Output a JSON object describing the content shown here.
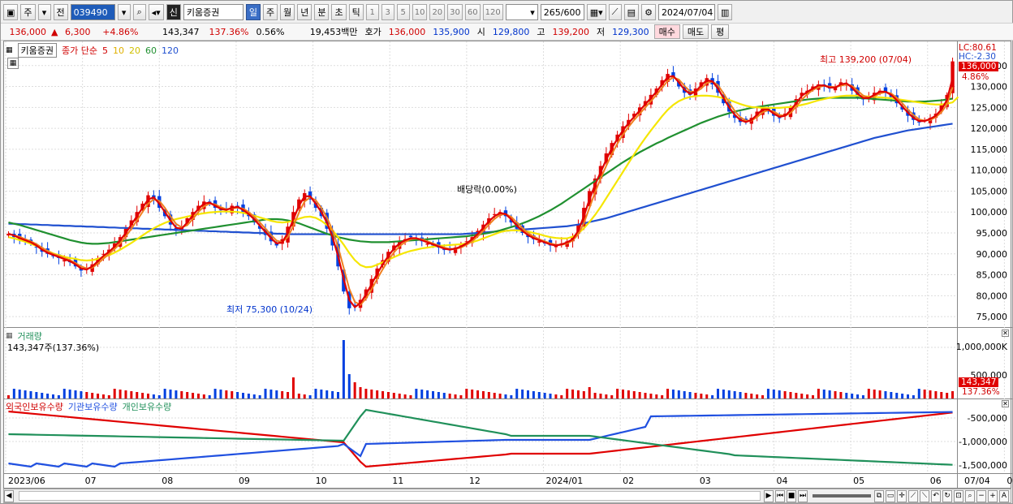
{
  "toolbar": {
    "tab1": "주",
    "tab2": "전",
    "code": "039490",
    "stock_name": "키움증권",
    "period_buttons": [
      "일",
      "주",
      "월",
      "년",
      "분",
      "초",
      "틱"
    ],
    "number_buttons": [
      "1",
      "3",
      "5",
      "10",
      "20",
      "30",
      "60",
      "120"
    ],
    "count": "265",
    "count_total": "/600",
    "date": "2024/07/04",
    "badge": "신"
  },
  "quote": {
    "price": "136,000",
    "change": "6,300",
    "rate": "+4.86%",
    "volume": "143,347",
    "volume_ratio": "137.36%",
    "turnover": "0.56%",
    "amount": "19,453백만",
    "hoga_label": "호가",
    "ask": "136,000",
    "bid": "135,900",
    "open_label": "시",
    "open": "129,800",
    "high_label": "고",
    "high": "139,200",
    "low_label": "저",
    "low": "129,300",
    "buy": "매수",
    "sell": "매도",
    "eval": "평"
  },
  "price_panel": {
    "stock_label": "키움증권",
    "ma_label": "종가 단순",
    "ma_periods": [
      "5",
      "10",
      "20",
      "60",
      "120"
    ],
    "lc": "LC:80.61",
    "hc": "HC:-2.30",
    "current_tag": "136,000",
    "rate_tag": "4.86%",
    "high_note": "최고 139,200 (07/04)",
    "low_note": "최저 75,300 (10/24)",
    "dividend_note": "배당락(0.00%)",
    "y_ticks": [
      "135,000",
      "130,000",
      "125,000",
      "120,000",
      "115,000",
      "110,000",
      "105,000",
      "100,000",
      "95,000",
      "90,000",
      "85,000",
      "80,000",
      "75,000"
    ]
  },
  "volume_panel": {
    "title": "거래량",
    "value": "143,347주(137.36%)",
    "y_ticks": [
      "1,000,000K",
      "500,000"
    ],
    "tag1": "143,347",
    "tag2": "137.36%"
  },
  "holding_panel": {
    "legend": [
      "외국인보유수량",
      "기관보유수량",
      "개인보유수량"
    ],
    "y_ticks": [
      "-500,000",
      "-1,000,000",
      "-1,500,000"
    ]
  },
  "x_axis": [
    "2023/06",
    "07",
    "08",
    "09",
    "10",
    "11",
    "12",
    "2024/01",
    "02",
    "03",
    "04",
    "05",
    "06",
    "07",
    "07/04"
  ],
  "colors": {
    "up": "#e00000",
    "down": "#0040e0",
    "ma5": "#e00000",
    "ma10": "#f08020",
    "ma20": "#f5e600",
    "ma60": "#209030",
    "ma120": "#2050d0",
    "foreign": "#e00000",
    "inst": "#2050e0",
    "indiv": "#20905a"
  },
  "chart_data": {
    "type": "line",
    "price_axis": {
      "min": 72500,
      "max": 140000
    },
    "price_close": [
      94800,
      94000,
      93500,
      93000,
      92500,
      91500,
      90500,
      90000,
      89500,
      89000,
      88500,
      88000,
      87000,
      86000,
      86500,
      87500,
      89000,
      90000,
      91000,
      92500,
      94000,
      96000,
      98000,
      100000,
      102000,
      104000,
      103000,
      101000,
      99000,
      97000,
      95500,
      96500,
      98500,
      100000,
      101500,
      102500,
      102000,
      101000,
      100500,
      100500,
      101500,
      101000,
      100000,
      99000,
      97500,
      96000,
      94500,
      93000,
      92000,
      93500,
      96500,
      100000,
      103000,
      104500,
      103000,
      101000,
      99000,
      96000,
      92000,
      87000,
      81000,
      77000,
      77500,
      79000,
      81500,
      84000,
      86500,
      88500,
      90500,
      92000,
      93000,
      93500,
      94000,
      93500,
      93000,
      92500,
      92000,
      91500,
      91000,
      91000,
      91500,
      92000,
      93000,
      94000,
      95500,
      97000,
      98500,
      99500,
      100000,
      99000,
      97500,
      96000,
      95000,
      94000,
      93500,
      93000,
      92500,
      92000,
      92000,
      92500,
      93000,
      94000,
      97000,
      101000,
      105000,
      108000,
      111000,
      114000,
      116500,
      118500,
      120500,
      122000,
      123500,
      125000,
      126500,
      128000,
      129500,
      131500,
      133000,
      132000,
      130000,
      128500,
      128000,
      129500,
      131000,
      132000,
      130500,
      128500,
      126000,
      124000,
      122500,
      121500,
      121500,
      122500,
      124000,
      125000,
      124000,
      123000,
      122500,
      123500,
      125000,
      127000,
      128500,
      129000,
      130000,
      130500,
      130000,
      129500,
      130000,
      131000,
      130500,
      129000,
      127500,
      127000,
      127500,
      128500,
      129000,
      128500,
      127500,
      126000,
      124500,
      123000,
      122000,
      121500,
      122000,
      122500,
      123500,
      125500,
      128000,
      136000
    ],
    "ma20": [
      94000,
      93700,
      93300,
      92900,
      92400,
      91900,
      91300,
      90700,
      90100,
      89700,
      89300,
      89000,
      88800,
      88500,
      88400,
      88500,
      88800,
      89200,
      89700,
      90300,
      91000,
      91800,
      92600,
      93500,
      94400,
      95300,
      96100,
      96800,
      97400,
      97900,
      98300,
      98600,
      98900,
      99200,
      99500,
      99700,
      99900,
      100000,
      100100,
      100100,
      100100,
      100000,
      99800,
      99500,
      99100,
      98700,
      98300,
      97900,
      97600,
      97500,
      97600,
      97900,
      98400,
      98800,
      98900,
      98600,
      97900,
      96900,
      95600,
      94000,
      92200,
      90200,
      88500,
      87300,
      86800,
      86900,
      87400,
      88000,
      88600,
      89200,
      89800,
      90300,
      90700,
      91000,
      91300,
      91500,
      91700,
      91900,
      92000,
      92100,
      92200,
      92300,
      92500,
      92800,
      93200,
      93700,
      94200,
      94700,
      95200,
      95500,
      95600,
      95600,
      95500,
      95300,
      95000,
      94700,
      94300,
      94000,
      93800,
      93700,
      93700,
      94100,
      94900,
      96100,
      97600,
      99300,
      101200,
      103300,
      105400,
      107500,
      109600,
      111700,
      113800,
      115800,
      117700,
      119500,
      121200,
      122900,
      124400,
      125600,
      126500,
      127100,
      127500,
      127700,
      127800,
      127800,
      127700,
      127500,
      127200,
      126800,
      126300,
      125800,
      125400,
      125100,
      125000,
      124900,
      124900,
      124900,
      124900,
      125000,
      125100,
      125300,
      125600,
      125900,
      126300,
      126700,
      127000,
      127300,
      127500,
      127700,
      127800,
      127800,
      127800,
      127700,
      127600,
      127500,
      127400,
      127300,
      127200,
      127000,
      126800,
      126600,
      126400,
      126200,
      126000,
      125800,
      125700,
      125700,
      125900,
      126200,
      127500
    ],
    "ma60": [
      97500,
      97200,
      96900,
      96500,
      96100,
      95700,
      95300,
      94900,
      94500,
      94100,
      93700,
      93300,
      93000,
      92700,
      92500,
      92400,
      92400,
      92500,
      92600,
      92800,
      93000,
      93200,
      93400,
      93600,
      93800,
      94000,
      94200,
      94400,
      94600,
      94800,
      95000,
      95200,
      95400,
      95600,
      95800,
      96000,
      96200,
      96400,
      96600,
      96800,
      97000,
      97200,
      97400,
      97600,
      97800,
      98000,
      98200,
      98300,
      98300,
      98200,
      98000,
      97700,
      97300,
      96800,
      96300,
      95800,
      95300,
      94800,
      94400,
      94000,
      93700,
      93400,
      93200,
      93000,
      92900,
      92800,
      92800,
      92800,
      92800,
      92900,
      93000,
      93100,
      93200,
      93300,
      93400,
      93500,
      93600,
      93700,
      93800,
      93900,
      94000,
      94100,
      94200,
      94400,
      94600,
      94800,
      95000,
      95300,
      95600,
      96000,
      96400,
      96800,
      97300,
      97800,
      98400,
      99000,
      99700,
      100400,
      101200,
      102000,
      102900,
      103800,
      104700,
      105600,
      106500,
      107400,
      108300,
      109200,
      110100,
      111000,
      111900,
      112700,
      113500,
      114300,
      115000,
      115700,
      116400,
      117000,
      117700,
      118300,
      118900,
      119500,
      120100,
      120700,
      121300,
      121800,
      122300,
      122800,
      123200,
      123600,
      124000,
      124300,
      124600,
      124900,
      125100,
      125300,
      125500,
      125700,
      125900,
      126100,
      126300,
      126500,
      126700,
      126900,
      127000,
      127100,
      127200,
      127300,
      127300,
      127300,
      127300,
      127300,
      127300,
      127200,
      127100,
      127000,
      126900,
      126800,
      126700,
      126600,
      126500,
      126400,
      126400,
      126400,
      126400,
      126500,
      126600,
      126700,
      126900,
      127100
    ],
    "ma120": [
      97200,
      97200,
      97100,
      97100,
      97000,
      97000,
      96900,
      96900,
      96800,
      96800,
      96700,
      96700,
      96600,
      96600,
      96500,
      96500,
      96400,
      96400,
      96300,
      96300,
      96200,
      96200,
      96100,
      96100,
      96000,
      96000,
      95900,
      95900,
      95800,
      95800,
      95700,
      95700,
      95600,
      95600,
      95500,
      95500,
      95400,
      95400,
      95300,
      95300,
      95200,
      95200,
      95100,
      95100,
      95000,
      95000,
      94900,
      94900,
      94800,
      94800,
      94700,
      94700,
      94700,
      94700,
      94700,
      94700,
      94700,
      94700,
      94700,
      94700,
      94700,
      94700,
      94700,
      94700,
      94700,
      94700,
      94700,
      94700,
      94700,
      94700,
      94700,
      94700,
      94700,
      94700,
      94700,
      94700,
      94700,
      94700,
      94700,
      94700,
      94700,
      94700,
      94800,
      94900,
      95000,
      95100,
      95200,
      95300,
      95400,
      95500,
      95600,
      95700,
      95800,
      95900,
      96000,
      96100,
      96200,
      96300,
      96400,
      96500,
      96600,
      96800,
      97000,
      97300,
      97600,
      97900,
      98200,
      98500,
      98900,
      99300,
      99700,
      100100,
      100500,
      100900,
      101300,
      101700,
      102100,
      102500,
      102900,
      103300,
      103700,
      104100,
      104500,
      104900,
      105300,
      105700,
      106100,
      106500,
      106900,
      107300,
      107700,
      108100,
      108500,
      108900,
      109300,
      109700,
      110100,
      110500,
      110900,
      111300,
      111700,
      112100,
      112500,
      112900,
      113300,
      113700,
      114100,
      114500,
      114900,
      115300,
      115700,
      116100,
      116500,
      116900,
      117300,
      117700,
      118000,
      118300,
      118600,
      118900,
      119200,
      119500,
      119700,
      119900,
      120100,
      120300,
      120500,
      120700,
      120900,
      121100
    ]
  }
}
